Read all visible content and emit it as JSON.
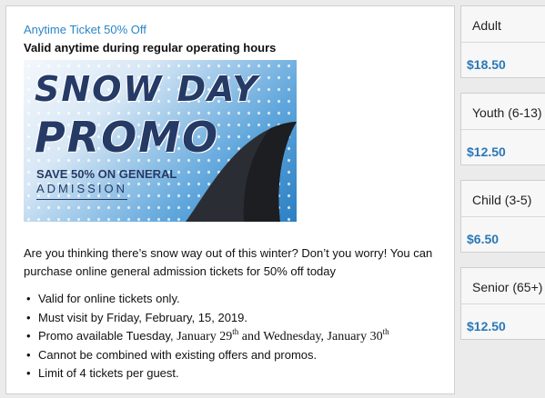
{
  "offer": {
    "title": "Anytime Ticket 50% Off",
    "subtitle": "Valid anytime during regular operating hours"
  },
  "promo_image": {
    "line1": "SNOW DAY",
    "line2": "PROMO",
    "line3": "SAVE 50% ON GENERAL",
    "line4": "ADMISSION",
    "shark_fin_icon": "shark-fin",
    "colors": {
      "navy": "#263a66",
      "blue": "#2b7fc4",
      "fin": "#2a2d33"
    }
  },
  "description": {
    "intro": "Are you thinking there’s snow way out of this winter? Don’t you worry! You can purchase online general admission tickets for 50% off today",
    "bullets": [
      {
        "text": "Valid for online tickets only."
      },
      {
        "text": "Must visit by Friday, February, 15, 2019."
      },
      {
        "pre": "Promo available Tuesday, ",
        "date1": "January 29",
        "sup1": "th",
        "mid": " and Wednesday, ",
        "date2": "January 30",
        "sup2": "th"
      },
      {
        "text": "Cannot be combined with existing offers and promos."
      },
      {
        "text": "Limit of 4 tickets per guest."
      }
    ]
  },
  "tickets": [
    {
      "label": "Adult",
      "price": "$18.50"
    },
    {
      "label": "Youth (6-13)",
      "price": "$12.50"
    },
    {
      "label": "Child (3-5)",
      "price": "$6.50"
    },
    {
      "label": "Senior (65+)",
      "price": "$12.50"
    }
  ],
  "colors": {
    "link_blue": "#2a86c6",
    "price_blue": "#2a78b8",
    "background": "#ebebeb"
  }
}
